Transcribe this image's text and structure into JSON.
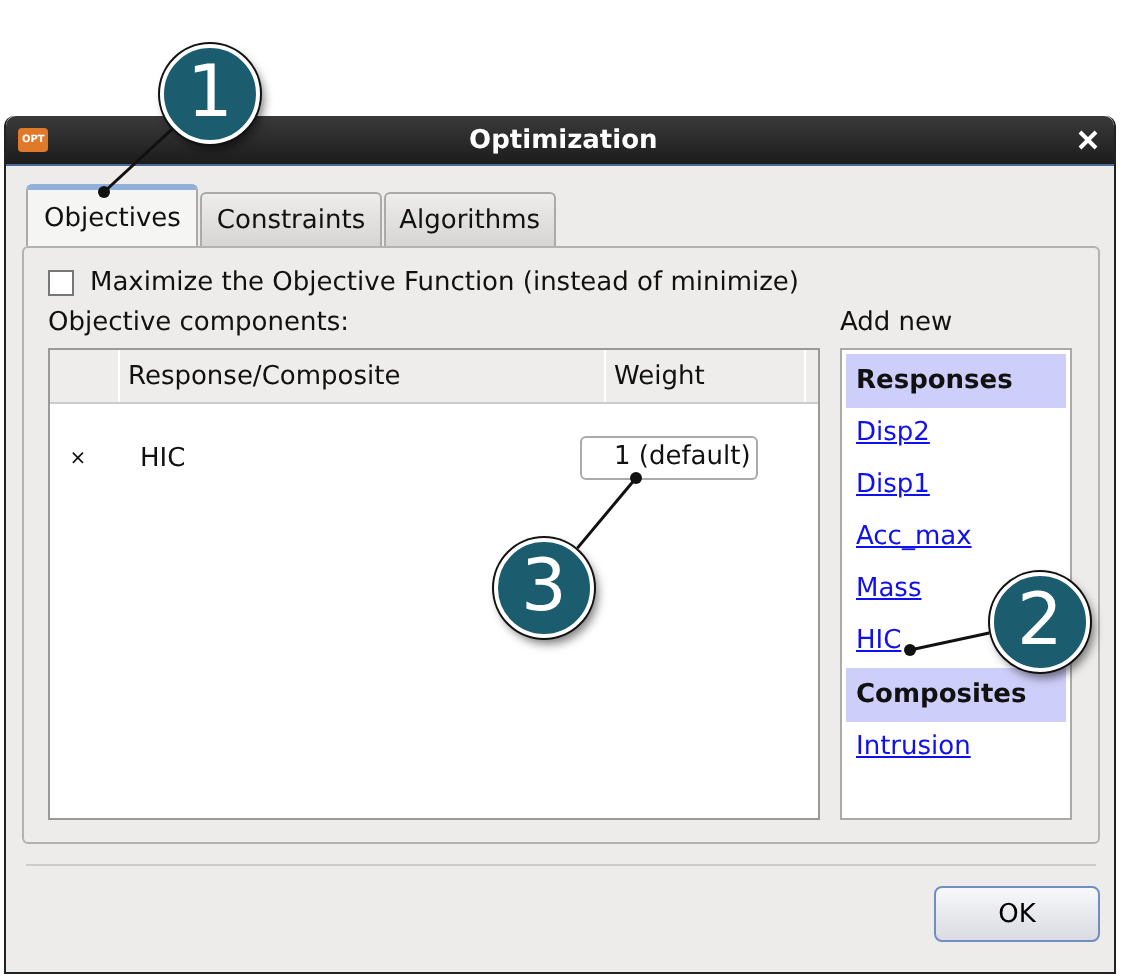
{
  "window": {
    "title": "Optimization",
    "app_icon_label": "OPT"
  },
  "tabs": [
    {
      "label": "Objectives",
      "selected": true
    },
    {
      "label": "Constraints",
      "selected": false
    },
    {
      "label": "Algorithms",
      "selected": false
    }
  ],
  "maximize": {
    "label": "Maximize the Objective Function (instead of minimize)",
    "checked": false
  },
  "components": {
    "label": "Objective components:",
    "columns": [
      "Response/Composite",
      "Weight"
    ],
    "rows": [
      {
        "remove": "×",
        "name": "HIC",
        "weight": "1 (default)"
      }
    ]
  },
  "add_new": {
    "label": "Add new",
    "groups": [
      {
        "title": "Responses",
        "items": [
          "Disp2",
          "Disp1",
          "Acc_max",
          "Mass",
          "HIC"
        ]
      },
      {
        "title": "Composites",
        "items": [
          "Intrusion"
        ]
      }
    ]
  },
  "buttons": [
    "OK"
  ],
  "callouts": [
    "1",
    "2",
    "3"
  ]
}
